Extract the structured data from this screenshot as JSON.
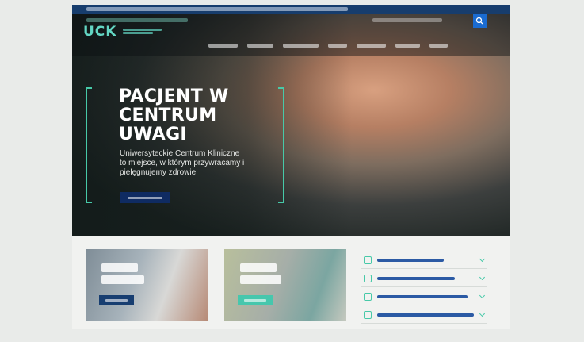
{
  "hero": {
    "title_lines": [
      "PACJENT W",
      "CENTRUM",
      "UWAGI"
    ],
    "subtitle": "Uniwersyteckie Centrum Kliniczne to miejsce, w którym przywracamy i pielęgnujemy zdrowie."
  },
  "brand": {
    "logo_mark": "UCK"
  },
  "icons": {
    "search": "search-icon",
    "link_icon": "link-icon",
    "chevron": "chevron-down-icon"
  },
  "colors": {
    "accent": "#47c9a8",
    "primary": "#173d6d",
    "cta": "#0f2b62"
  }
}
